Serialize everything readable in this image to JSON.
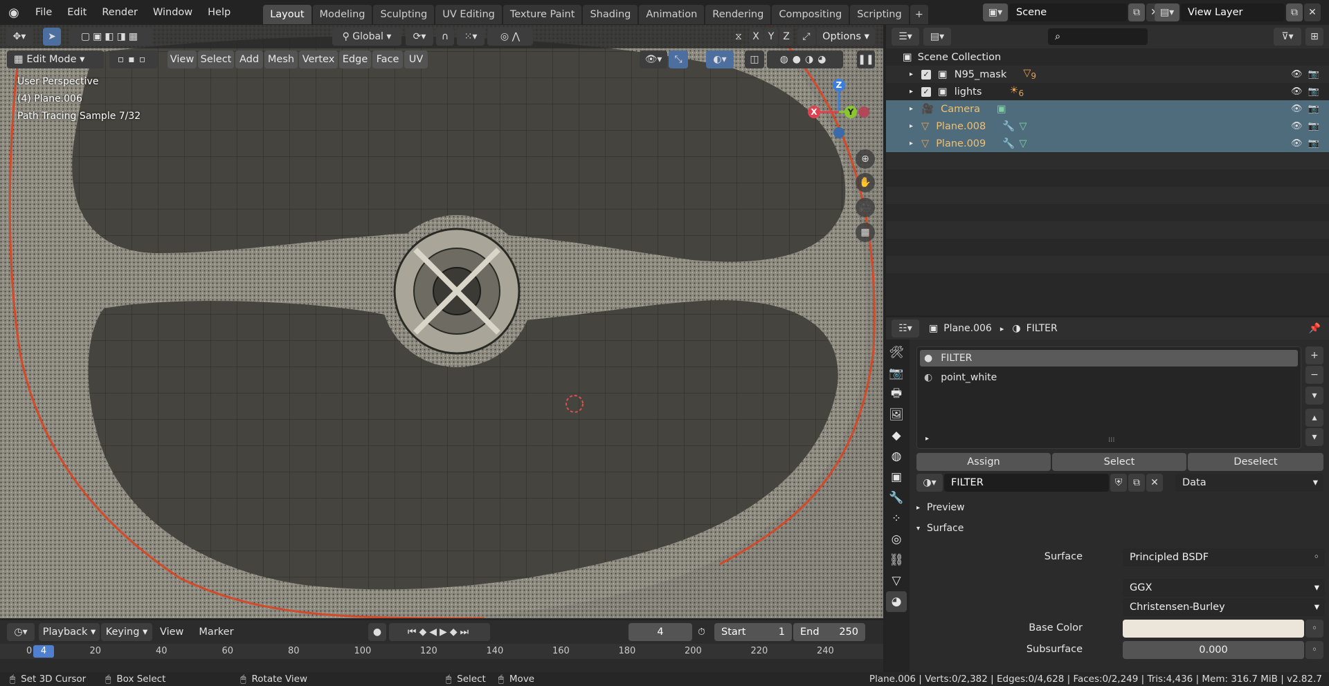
{
  "topbar": {
    "menus": [
      "File",
      "Edit",
      "Render",
      "Window",
      "Help"
    ],
    "workspaces": [
      "Layout",
      "Modeling",
      "Sculpting",
      "UV Editing",
      "Texture Paint",
      "Shading",
      "Animation",
      "Rendering",
      "Compositing",
      "Scripting"
    ],
    "add_tab": "+",
    "scene": "Scene",
    "view_layer": "View Layer"
  },
  "viewport": {
    "transform_orientation": "Global",
    "axes": [
      "X",
      "Y",
      "Z"
    ],
    "options": "Options",
    "mode": "Edit Mode",
    "menus": [
      "View",
      "Select",
      "Add",
      "Mesh",
      "Vertex",
      "Edge",
      "Face",
      "UV"
    ],
    "overlay_lines": [
      "User Perspective",
      "(4) Plane.006",
      "Path Tracing Sample 7/32"
    ],
    "gizmo": {
      "x": "X",
      "y": "Y",
      "z": "Z"
    }
  },
  "outliner": {
    "search_placeholder": "",
    "scene_collection": "Scene Collection",
    "items": [
      {
        "name": "N95_mask",
        "badge": "9",
        "selected": false
      },
      {
        "name": "lights",
        "badge": "6",
        "selected": false
      },
      {
        "name": "Camera",
        "badge": "",
        "selected": true
      },
      {
        "name": "Plane.008",
        "badge": "",
        "selected": true
      },
      {
        "name": "Plane.009",
        "badge": "",
        "selected": true
      }
    ]
  },
  "properties": {
    "breadcrumb_object": "Plane.006",
    "breadcrumb_material": "FILTER",
    "slots": [
      "FILTER",
      "point_white"
    ],
    "assign": "Assign",
    "select": "Select",
    "deselect": "Deselect",
    "material_name": "FILTER",
    "link": "Data",
    "preview_label": "Preview",
    "surface_panel": "Surface",
    "surface_label": "Surface",
    "surface_value": "Principled BSDF",
    "distribution": "GGX",
    "subsurface_method": "Christensen-Burley",
    "base_color_label": "Base Color",
    "base_color": "#ece6da",
    "subsurface_label": "Subsurface",
    "subsurface_value": "0.000"
  },
  "timeline": {
    "playback": "Playback",
    "keying": "Keying",
    "view": "View",
    "marker": "Marker",
    "current_frame": "4",
    "start_label": "Start",
    "start": "1",
    "end_label": "End",
    "end": "250",
    "ruler_current": "4",
    "ruler": [
      "0",
      "20",
      "40",
      "60",
      "80",
      "100",
      "120",
      "140",
      "160",
      "180",
      "200",
      "220",
      "240"
    ]
  },
  "statusbar": {
    "set_cursor": "Set 3D Cursor",
    "box_select": "Box Select",
    "rotate_view": "Rotate View",
    "select": "Select",
    "move": "Move",
    "stats": "Plane.006 | Verts:0/2,382 | Edges:0/4,628 | Faces:0/2,249 | Tris:4,436 | Mem: 316.7 MiB | v2.82.7"
  }
}
